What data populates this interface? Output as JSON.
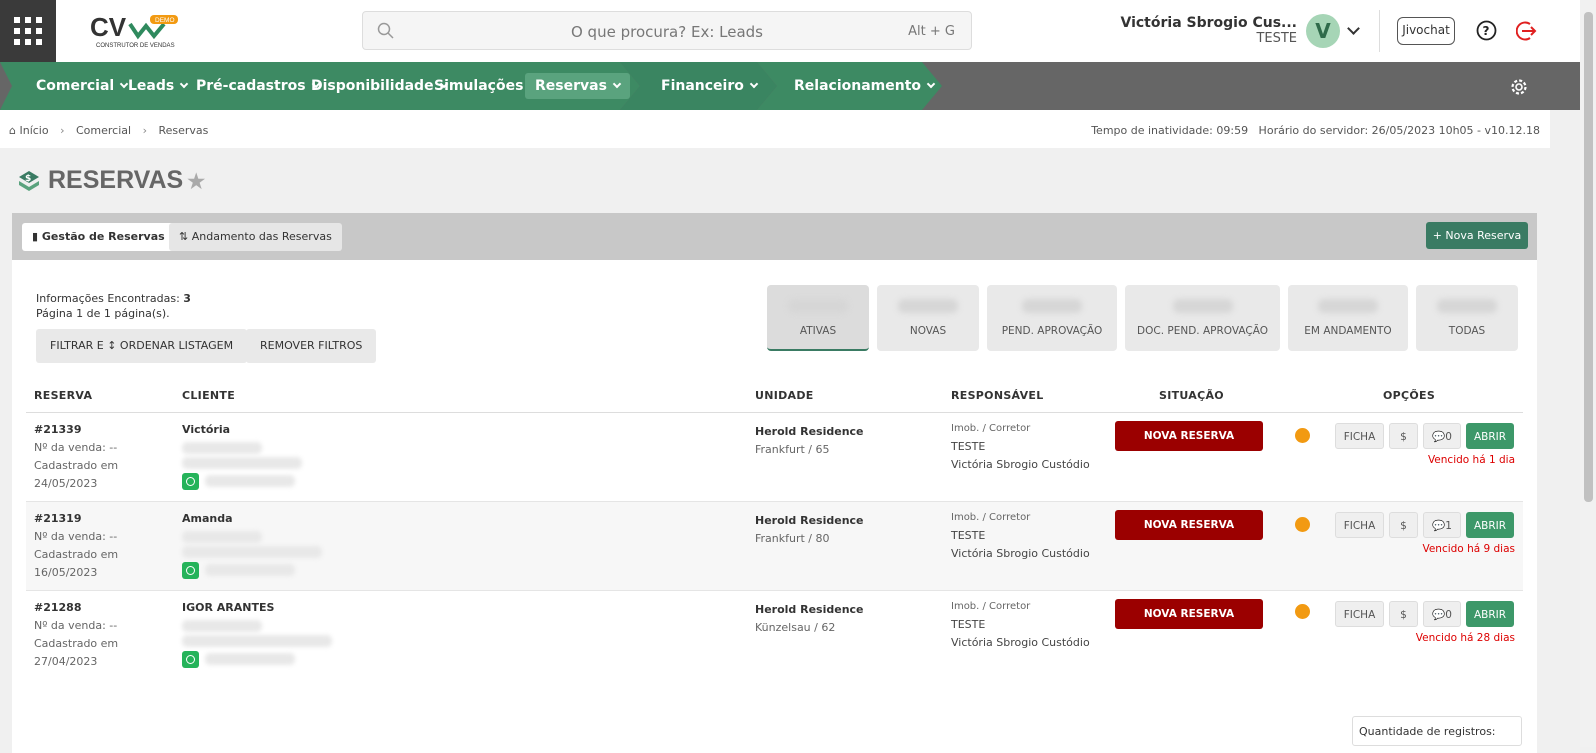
{
  "app": {
    "logo_text": "CV",
    "logo_badge": "DEMO",
    "logo_sub": "CONSTRUTOR DE VENDAS"
  },
  "search": {
    "placeholder": "O que procura? Ex: Leads",
    "shortcut": "Alt + G"
  },
  "user": {
    "name": "Victória Sbrogio Cus...",
    "org": "TESTE",
    "initial": "V"
  },
  "header": {
    "jivo_label": "Jivochat"
  },
  "nav": {
    "items": [
      {
        "label": "Comercial"
      },
      {
        "label": "Leads"
      },
      {
        "label": "Pré-cadastros"
      },
      {
        "label": "Disponibilidade"
      },
      {
        "label": "Simulações"
      },
      {
        "label": "Reservas"
      },
      {
        "label": "Financeiro"
      },
      {
        "label": "Relacionamento"
      }
    ]
  },
  "breadcrumb": {
    "items": [
      "Início",
      "Comercial",
      "Reservas"
    ],
    "status": "Tempo de inatividade: 09:59   Horário do servidor: 26/05/2023 10h05 - v10.12.18"
  },
  "page": {
    "title": "RESERVAS"
  },
  "tabs": {
    "gestao": "Gestão de Reservas",
    "andamento": "Andamento das Reservas",
    "nova": "+ Nova Reserva"
  },
  "info": {
    "found_label": "Informações Encontradas:",
    "found_count": "3",
    "page_text": "Página 1 de 1 página(s)."
  },
  "filters": {
    "filter_label": "FILTRAR E ↕ ORDENAR LISTAGEM",
    "remove_label": "REMOVER FILTROS"
  },
  "status_tabs": [
    "ATIVAS",
    "NOVAS",
    "PEND. APROVAÇÃO",
    "DOC. PEND. APROVAÇÃO",
    "EM ANDAMENTO",
    "TODAS"
  ],
  "table": {
    "headers": [
      "RESERVA",
      "CLIENTE",
      "UNIDADE",
      "RESPONSÁVEL",
      "SITUAÇÃO",
      "OPÇÕES"
    ],
    "rows": [
      {
        "id": "#21339",
        "venda": "Nº da venda: --",
        "cad": "Cadastrado em",
        "date": "24/05/2023",
        "client": "Victória",
        "unit": "Herold Residence",
        "unit_sub": "Frankfurt / 65",
        "resp_type": "Imob. / Corretor",
        "resp_org": "TESTE",
        "resp_name": "Victória Sbrogio Custódio",
        "status": "NOVA RESERVA",
        "ficha": "FICHA",
        "money": "$",
        "comments": "0",
        "open": "ABRIR",
        "due": "Vencido há 1 dia"
      },
      {
        "id": "#21319",
        "venda": "Nº da venda: --",
        "cad": "Cadastrado em",
        "date": "16/05/2023",
        "client": "Amanda",
        "unit": "Herold Residence",
        "unit_sub": "Frankfurt / 80",
        "resp_type": "Imob. / Corretor",
        "resp_org": "TESTE",
        "resp_name": "Victória Sbrogio Custódio",
        "status": "NOVA RESERVA",
        "ficha": "FICHA",
        "money": "$",
        "comments": "1",
        "open": "ABRIR",
        "due": "Vencido há 9 dias"
      },
      {
        "id": "#21288",
        "venda": "Nº da venda: --",
        "cad": "Cadastrado em",
        "date": "27/04/2023",
        "client": "IGOR ARANTES",
        "unit": "Herold Residence",
        "unit_sub": "Künzelsau / 62",
        "resp_type": "Imob. / Corretor",
        "resp_org": "TESTE",
        "resp_name": "Victória Sbrogio Custódio",
        "status": "NOVA RESERVA",
        "ficha": "FICHA",
        "money": "$",
        "comments": "0",
        "open": "ABRIR",
        "due": "Vencido há 28 dias"
      }
    ]
  },
  "footer": {
    "qtd_label": "Quantidade de registros:"
  },
  "colors": {
    "nav_green": "#3d8a63",
    "status_red": "#9b0000",
    "accent": "#3a7b63"
  }
}
